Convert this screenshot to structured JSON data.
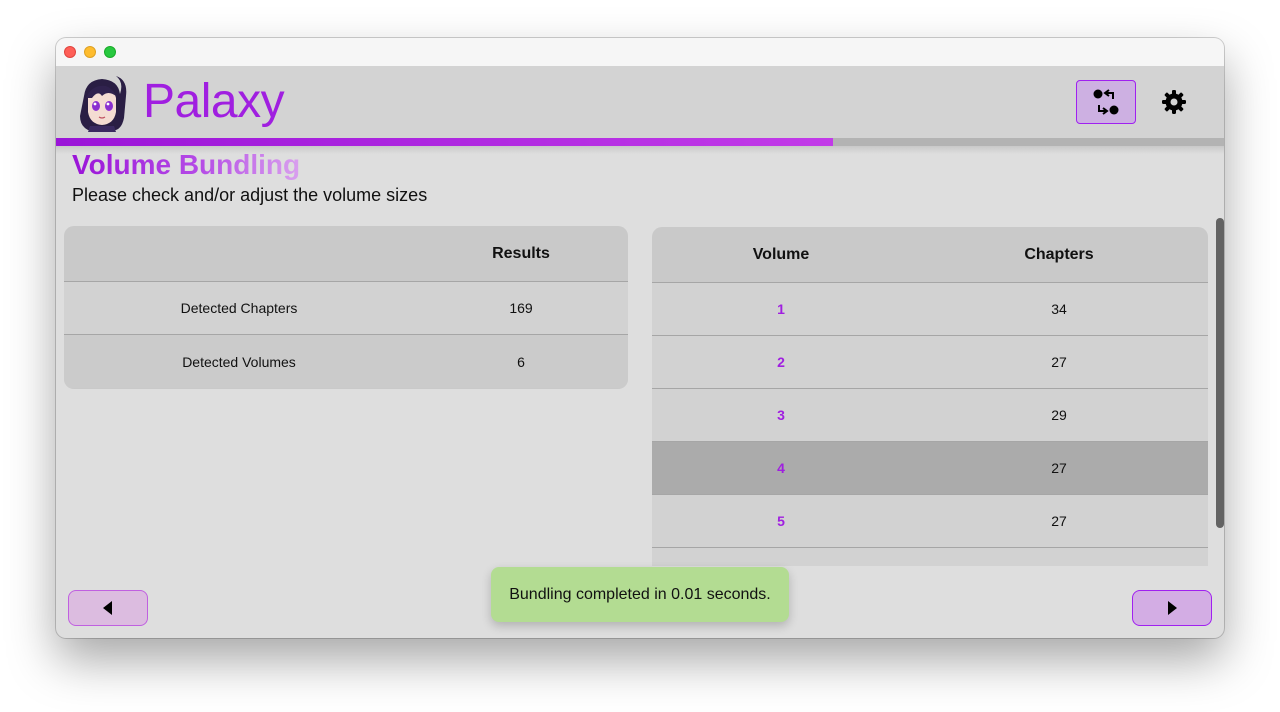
{
  "app": {
    "title": "Palaxy"
  },
  "header": {
    "swap_icon": "swap-arrows-icon",
    "settings_icon": "gear-icon"
  },
  "progress": {
    "fraction": 0.665,
    "color_start": "#9a14d8",
    "color_end": "#c23be8"
  },
  "page": {
    "heading": "Volume Bundling",
    "subtitle": "Please check and/or adjust the volume sizes"
  },
  "results_table": {
    "headers": [
      "",
      "Results"
    ],
    "rows": [
      {
        "label": "Detected Chapters",
        "value": "169"
      },
      {
        "label": "Detected Volumes",
        "value": "6"
      }
    ]
  },
  "volumes_table": {
    "headers": [
      "Volume",
      "Chapters"
    ],
    "rows": [
      {
        "volume": "1",
        "chapters": "34"
      },
      {
        "volume": "2",
        "chapters": "27"
      },
      {
        "volume": "3",
        "chapters": "29"
      },
      {
        "volume": "4",
        "chapters": "27"
      },
      {
        "volume": "5",
        "chapters": "27"
      }
    ],
    "selected_volume": "4"
  },
  "toast": {
    "message": "Bundling completed in 0.01 seconds."
  },
  "nav": {
    "back_icon": "caret-left-icon",
    "next_icon": "caret-right-icon"
  },
  "colors": {
    "accent": "#a01fe0",
    "toast_bg": "#b3dc92"
  }
}
